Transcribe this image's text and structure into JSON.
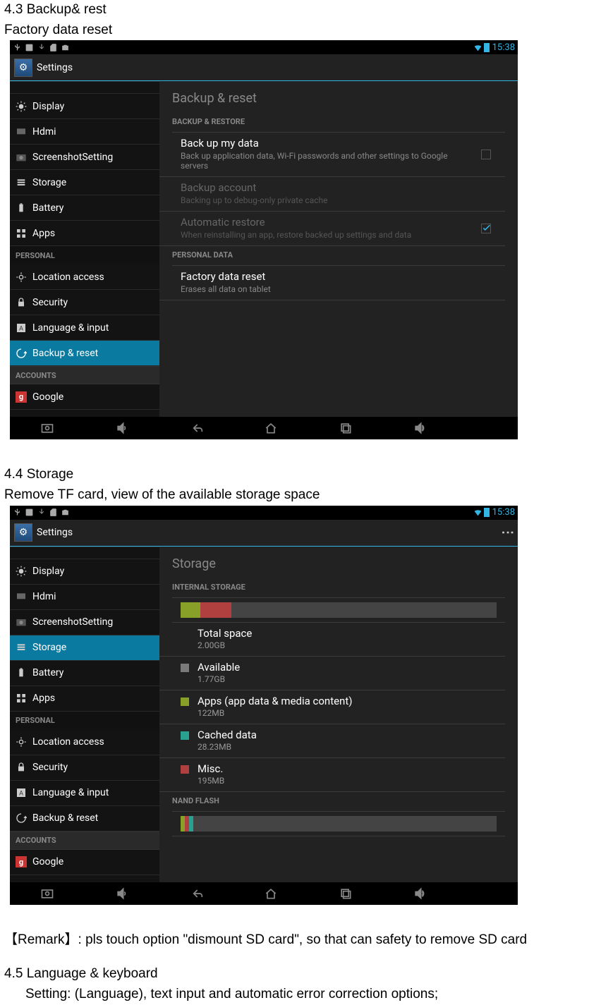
{
  "doc": {
    "sec43_title": "4.3 Backup& rest",
    "sec43_sub": "Factory data reset",
    "sec44_title": "4.4 Storage",
    "sec44_sub": "Remove TF card, view of the available storage space",
    "remark": "【Remark】: pls touch option \"dismount SD card\", so that can safety to remove SD card",
    "sec45_title": "4.5 Language & keyboard",
    "sec45_sub": "Setting: (Language), text input and automatic error correction options;"
  },
  "common": {
    "clock": "15:38",
    "settings_title": "Settings"
  },
  "sidebar_headers": {
    "personal": "PERSONAL",
    "accounts": "ACCOUNTS"
  },
  "sidebar": {
    "display": "Display",
    "hdmi": "Hdmi",
    "screenshot": "ScreenshotSetting",
    "storage": "Storage",
    "battery": "Battery",
    "apps": "Apps",
    "location": "Location access",
    "security": "Security",
    "language": "Language & input",
    "backup": "Backup & reset",
    "google": "Google"
  },
  "backup_pane": {
    "header": "Backup & reset",
    "section1": "BACKUP & RESTORE",
    "item1_t": "Back up my data",
    "item1_s": "Back up application data, Wi-Fi passwords and other settings to Google servers",
    "item2_t": "Backup account",
    "item2_s": "Backing up to debug-only private cache",
    "item3_t": "Automatic restore",
    "item3_s": "When reinstalling an app, restore backed up settings and data",
    "section2": "PERSONAL DATA",
    "item4_t": "Factory data reset",
    "item4_s": "Erases all data on tablet"
  },
  "storage_pane": {
    "header": "Storage",
    "section1": "INTERNAL STORAGE",
    "total_t": "Total space",
    "total_v": "2.00GB",
    "avail_t": "Available",
    "avail_v": "1.77GB",
    "apps_t": "Apps (app data & media content)",
    "apps_v": "122MB",
    "cache_t": "Cached data",
    "cache_v": "28.23MB",
    "misc_t": "Misc.",
    "misc_v": "195MB",
    "section2": "NAND FLASH"
  }
}
